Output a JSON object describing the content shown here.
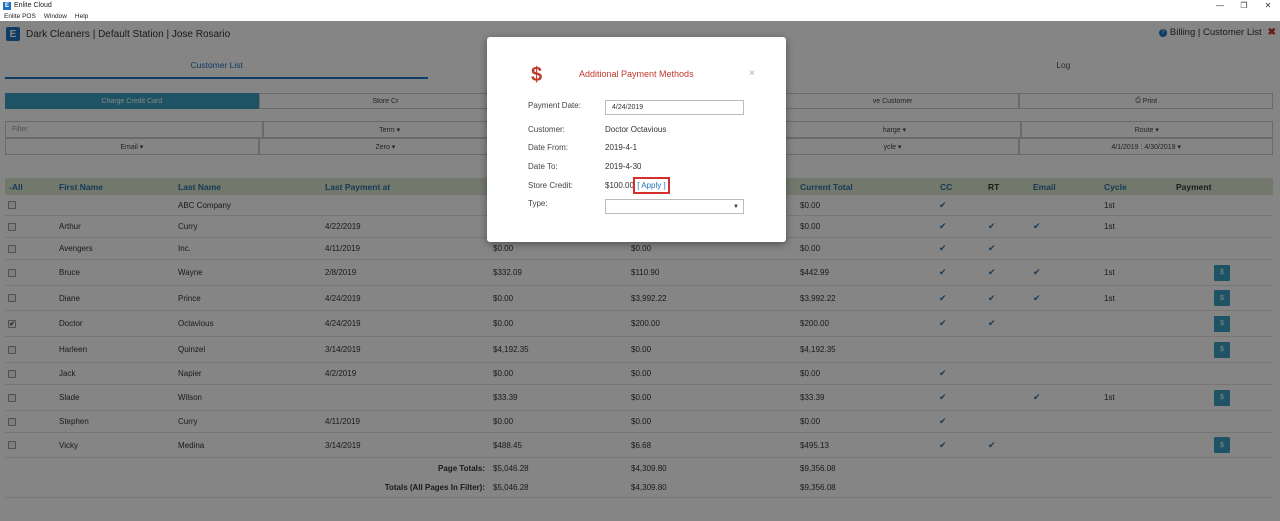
{
  "window": {
    "title": "Enlite Cloud",
    "menu": [
      "Enlite POS",
      "Window",
      "Help"
    ]
  },
  "header": {
    "company": "Dark Cleaners | Default Station | Jose Rosario",
    "right": "Billing | Customer List"
  },
  "tabs": [
    "Customer List",
    "",
    "Log"
  ],
  "actions": [
    "Charge Credit Card",
    "Store Cr",
    "",
    "ve Customer",
    "Print"
  ],
  "filters_row1": [
    "Filter",
    "Term ▾",
    "",
    "harge ▾",
    "Route ▾"
  ],
  "filters_row2": [
    "Email ▾",
    "Zero ▾",
    "",
    "ycle ▾",
    "4/1/2019 : 4/30/2019 ▾"
  ],
  "table": {
    "headers": [
      "-All",
      "First Name",
      "Last Name",
      "Last Payment at",
      "",
      "",
      "Current Total",
      "CC",
      "RT",
      "Email",
      "Cycle",
      "Payment"
    ],
    "rows": [
      {
        "checked": false,
        "first": "",
        "last": "ABC Company",
        "last_payment": "",
        "c1": "",
        "c2": "",
        "total": "$0.00",
        "cc": true,
        "rt": false,
        "email": false,
        "cycle": "1st",
        "pay": false
      },
      {
        "checked": false,
        "first": "Arthur",
        "last": "Curry",
        "last_payment": "4/22/2019",
        "c1": "",
        "c2": "",
        "total": "$0.00",
        "cc": true,
        "rt": true,
        "email": true,
        "cycle": "1st",
        "pay": false
      },
      {
        "checked": false,
        "first": "Avengers",
        "last": "Inc.",
        "last_payment": "4/11/2019",
        "c1": "$0.00",
        "c2": "$0.00",
        "total": "$0.00",
        "cc": true,
        "rt": true,
        "email": false,
        "cycle": "",
        "pay": false
      },
      {
        "checked": false,
        "first": "Bruce",
        "last": "Wayne",
        "last_payment": "2/8/2019",
        "c1": "$332.09",
        "c2": "$110.90",
        "total": "$442.99",
        "cc": true,
        "rt": true,
        "email": true,
        "cycle": "1st",
        "pay": true
      },
      {
        "checked": false,
        "first": "Diane",
        "last": "Prince",
        "last_payment": "4/24/2019",
        "c1": "$0.00",
        "c2": "$3,992.22",
        "total": "$3,992.22",
        "cc": true,
        "rt": true,
        "email": true,
        "cycle": "1st",
        "pay": true
      },
      {
        "checked": true,
        "first": "Doctor",
        "last": "Octavious",
        "last_payment": "4/24/2019",
        "c1": "$0.00",
        "c2": "$200.00",
        "total": "$200.00",
        "cc": true,
        "rt": true,
        "email": false,
        "cycle": "",
        "pay": true
      },
      {
        "checked": false,
        "first": "Harleen",
        "last": "Quinzel",
        "last_payment": "3/14/2019",
        "c1": "$4,192.35",
        "c2": "$0.00",
        "total": "$4,192.35",
        "cc": false,
        "rt": false,
        "email": false,
        "cycle": "",
        "pay": true
      },
      {
        "checked": false,
        "first": "Jack",
        "last": "Napier",
        "last_payment": "4/2/2019",
        "c1": "$0.00",
        "c2": "$0.00",
        "total": "$0.00",
        "cc": true,
        "rt": false,
        "email": false,
        "cycle": "",
        "pay": false
      },
      {
        "checked": false,
        "first": "Slade",
        "last": "Wilson",
        "last_payment": "",
        "c1": "$33.39",
        "c2": "$0.00",
        "total": "$33.39",
        "cc": true,
        "rt": false,
        "email": true,
        "cycle": "1st",
        "pay": true
      },
      {
        "checked": false,
        "first": "Stephen",
        "last": "Curry",
        "last_payment": "4/11/2019",
        "c1": "$0.00",
        "c2": "$0.00",
        "total": "$0.00",
        "cc": true,
        "rt": false,
        "email": false,
        "cycle": "",
        "pay": false
      },
      {
        "checked": false,
        "first": "Vicky",
        "last": "Medina",
        "last_payment": "3/14/2019",
        "c1": "$488.45",
        "c2": "$6.68",
        "total": "$495.13",
        "cc": true,
        "rt": true,
        "email": false,
        "cycle": "",
        "pay": true
      }
    ],
    "page_totals": {
      "label": "Page Totals:",
      "c1": "$5,046.28",
      "c2": "$4,309.80",
      "total": "$9,356.08"
    },
    "all_totals": {
      "label": "Totals (All Pages In Filter):",
      "c1": "$5,046.28",
      "c2": "$4,309.80",
      "total": "$9,356.08"
    }
  },
  "modal": {
    "icon": "$",
    "title": "Additional Payment Methods",
    "close": "×",
    "payment_date_label": "Payment Date:",
    "payment_date_value": "4/24/2019",
    "customer_label": "Customer:",
    "customer_value": "Doctor Octavious",
    "date_from_label": "Date From:",
    "date_from_value": "2019-4-1",
    "date_to_label": "Date To:",
    "date_to_value": "2019-4-30",
    "store_credit_label": "Store Credit:",
    "store_credit_value": "$100.00",
    "apply_label": "[ Apply ]",
    "type_label": "Type:",
    "type_value": ""
  },
  "icons": {
    "check": "✔",
    "tick": "✔",
    "pay": "$"
  }
}
